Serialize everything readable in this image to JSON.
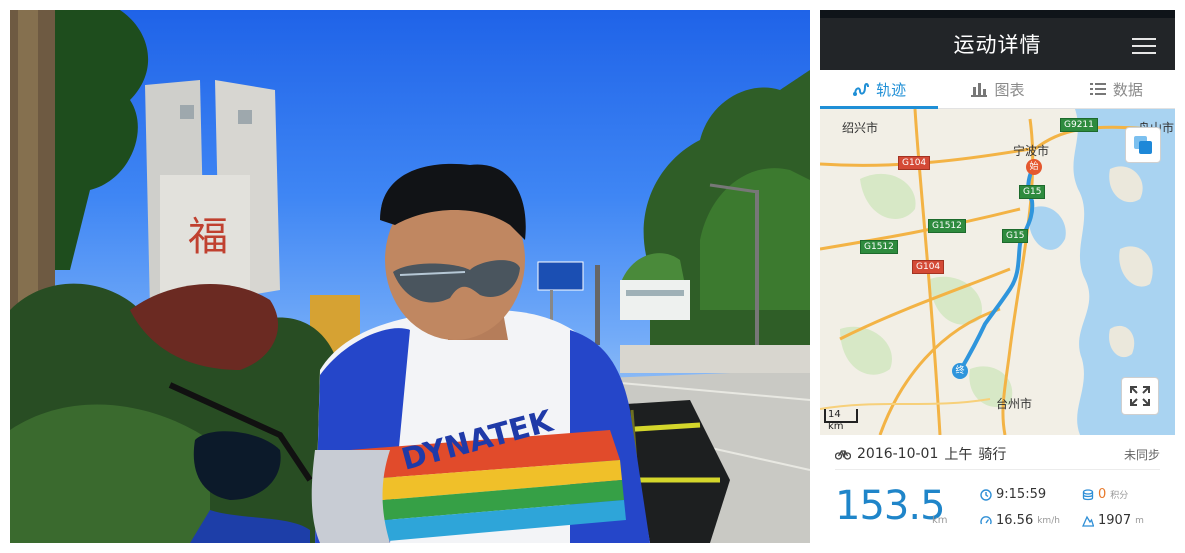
{
  "app": {
    "title": "运动详情",
    "tabs": [
      {
        "label": "轨迹",
        "icon": "track-icon",
        "active": true
      },
      {
        "label": "图表",
        "icon": "bar-chart-icon",
        "active": false
      },
      {
        "label": "数据",
        "icon": "list-icon",
        "active": false
      }
    ],
    "accent_color": "#1f8fd6"
  },
  "photo": {
    "sign_text": "福"
  },
  "map": {
    "cities": [
      "绍兴市",
      "宁波市",
      "台州市"
    ],
    "roads": [
      "G9211",
      "G104",
      "G15",
      "G1512",
      "G1512",
      "G15",
      "G104"
    ],
    "partial_label": "舟山市",
    "start_marker": "始",
    "end_marker": "终",
    "scale": "14 km"
  },
  "activity": {
    "date": "2016-10-01",
    "time_of_day": "上午",
    "type": "骑行",
    "sync_status": "未同步",
    "distance": "153.5",
    "distance_unit": "km",
    "duration": "9:15:59",
    "speed": "16.56",
    "speed_unit": "km/h",
    "points": "0",
    "points_unit": "积分",
    "elevation": "1907",
    "elevation_unit": "m"
  }
}
